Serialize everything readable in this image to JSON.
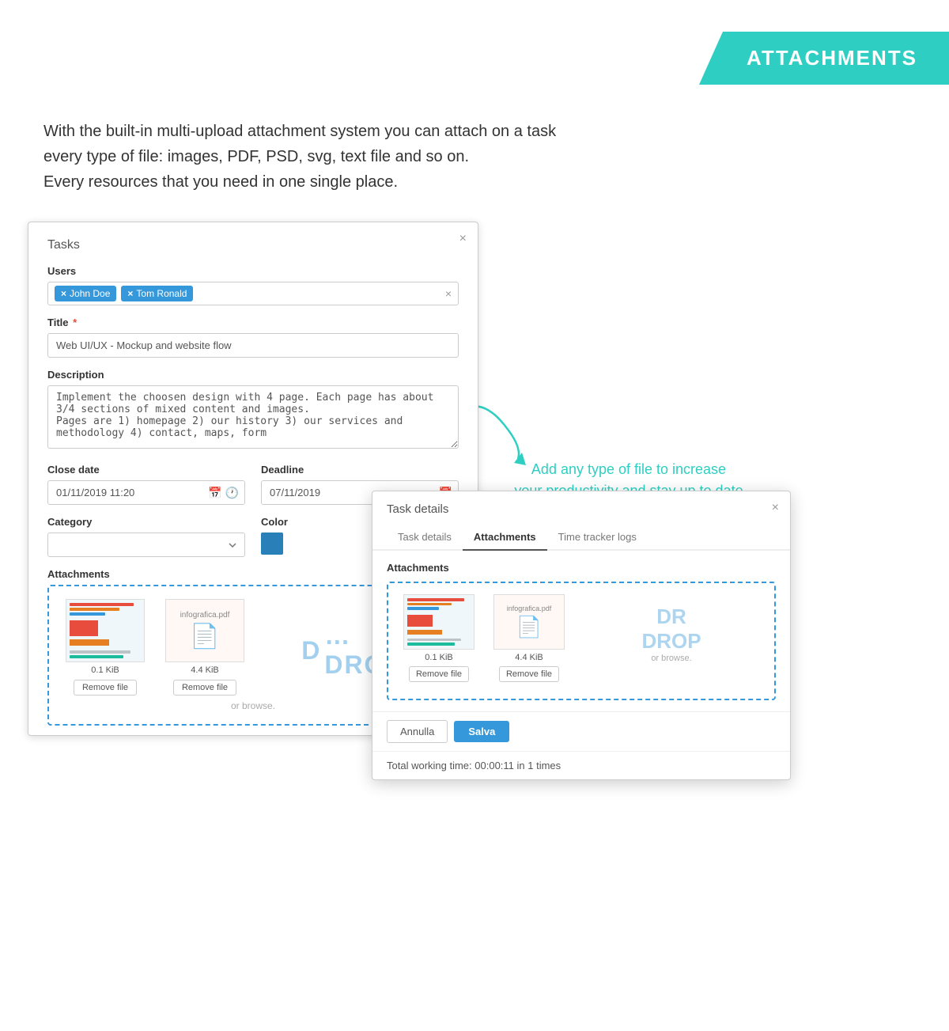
{
  "header": {
    "title": "ATTACHMENTS"
  },
  "intro": {
    "line1": "With the built-in multi-upload attachment system you can attach on a task",
    "line2": "every type of file: images, PDF, PSD, svg, text file and so on.",
    "line3": "Every resources that you need in one single place."
  },
  "arrow_caption": {
    "line1": "Add any type of file to increase",
    "line2": "your productivity and stay up to date"
  },
  "tasks_modal": {
    "title": "Tasks",
    "close": "×",
    "users_label": "Users",
    "users": [
      "John Doe",
      "Tom Ronald"
    ],
    "title_label": "Title",
    "title_required": "*",
    "title_value": "Web UI/UX - Mockup and website flow",
    "description_label": "Description",
    "description_value": "Implement the choosen design with 4 page. Each page has about 3/4 sections of mixed content and images.\nPages are 1) homepage 2) our history 3) our services and methodology 4) contact, maps, form",
    "close_date_label": "Close date",
    "close_date_value": "01/11/2019 11:20",
    "deadline_label": "Deadline",
    "deadline_value": "07/11/2019",
    "category_label": "Category",
    "color_label": "Color",
    "attachments_label": "Attachments",
    "files": [
      {
        "name": "",
        "size": "0.1 KiB",
        "remove": "Remove file"
      },
      {
        "name": "infografica.pdf",
        "size": "4.4 KiB",
        "remove": "Remove file"
      }
    ],
    "drop_text": "DROP",
    "drop_drag": "D",
    "drop_or": "or browse."
  },
  "taskdetails_modal": {
    "title": "Task details",
    "close": "×",
    "tabs": [
      "Task details",
      "Attachments",
      "Time tracker logs"
    ],
    "active_tab": "Attachments",
    "attachments_label": "Attachments",
    "files": [
      {
        "size": "0.1 KiB",
        "remove": "Remove file"
      },
      {
        "name": "infografica.pdf",
        "size": "4.4 KiB",
        "remove": "Remove file"
      }
    ],
    "drop_text": "DROP",
    "drop_or": "or browse.",
    "btn_annulla": "Annulla",
    "btn_salva": "Salva",
    "working_time": "Total working time: 00:00:11 in 1 times"
  }
}
